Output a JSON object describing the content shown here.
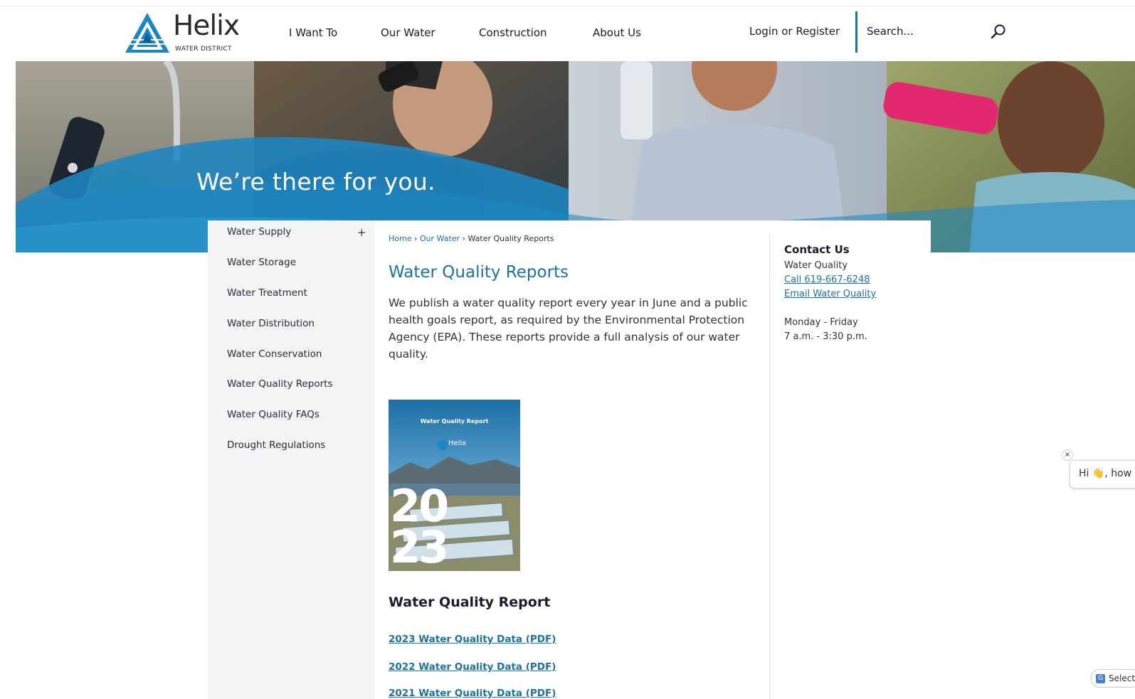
{
  "header": {
    "logo_word": "Helix",
    "logo_sub": "WATER DISTRICT",
    "nav": [
      "I Want To",
      "Our Water",
      "Construction",
      "About Us"
    ],
    "login_label": "Login or Register",
    "search_placeholder": "Search..."
  },
  "banner": {
    "tagline": "We’re there for you."
  },
  "sidebar": {
    "items": [
      {
        "label": "Water Supply"
      },
      {
        "label": "Water Storage"
      },
      {
        "label": "Water Treatment"
      },
      {
        "label": "Water Distribution"
      },
      {
        "label": "Water Conservation"
      },
      {
        "label": "Water Quality Reports"
      },
      {
        "label": "Water Quality FAQs"
      },
      {
        "label": "Drought Regulations"
      }
    ],
    "expand_symbol": "+"
  },
  "breadcrumb": {
    "home": "Home",
    "sep1": " › ",
    "parent": "Our Water",
    "sep2": " › ",
    "current": "Water Quality Reports"
  },
  "main": {
    "title": "Water Quality Reports",
    "intro": "We publish a water quality report every year in June and a public health goals report, as required by the Environmental Protection Agency (EPA). These reports provide a full analysis of our water quality.",
    "cover": {
      "title": "Water Quality Report",
      "brand": "Helix",
      "year_top": "20",
      "year_bottom": "23"
    },
    "section_heading": "Water Quality Report",
    "links": [
      "2023 Water Quality Data (PDF)",
      "2022 Water Quality Data (PDF)",
      "2021 Water Quality Data (PDF)"
    ]
  },
  "contact": {
    "title": "Contact Us",
    "department": "Water Quality",
    "phone_link": "Call 619-667-6248",
    "email_link": "Email Water Quality",
    "days": "Monday - Friday",
    "hours": "7 a.m. - 3:30 p.m."
  },
  "chat": {
    "greeting": "Hi 👋, how can I help?",
    "close": "×"
  },
  "translate": {
    "label": "Select Language",
    "icon": "G"
  },
  "colors": {
    "brand_blue": "#1b72a8",
    "sidebar_bg": "#f4f4f4",
    "banner_wave": "#1e86c2"
  }
}
